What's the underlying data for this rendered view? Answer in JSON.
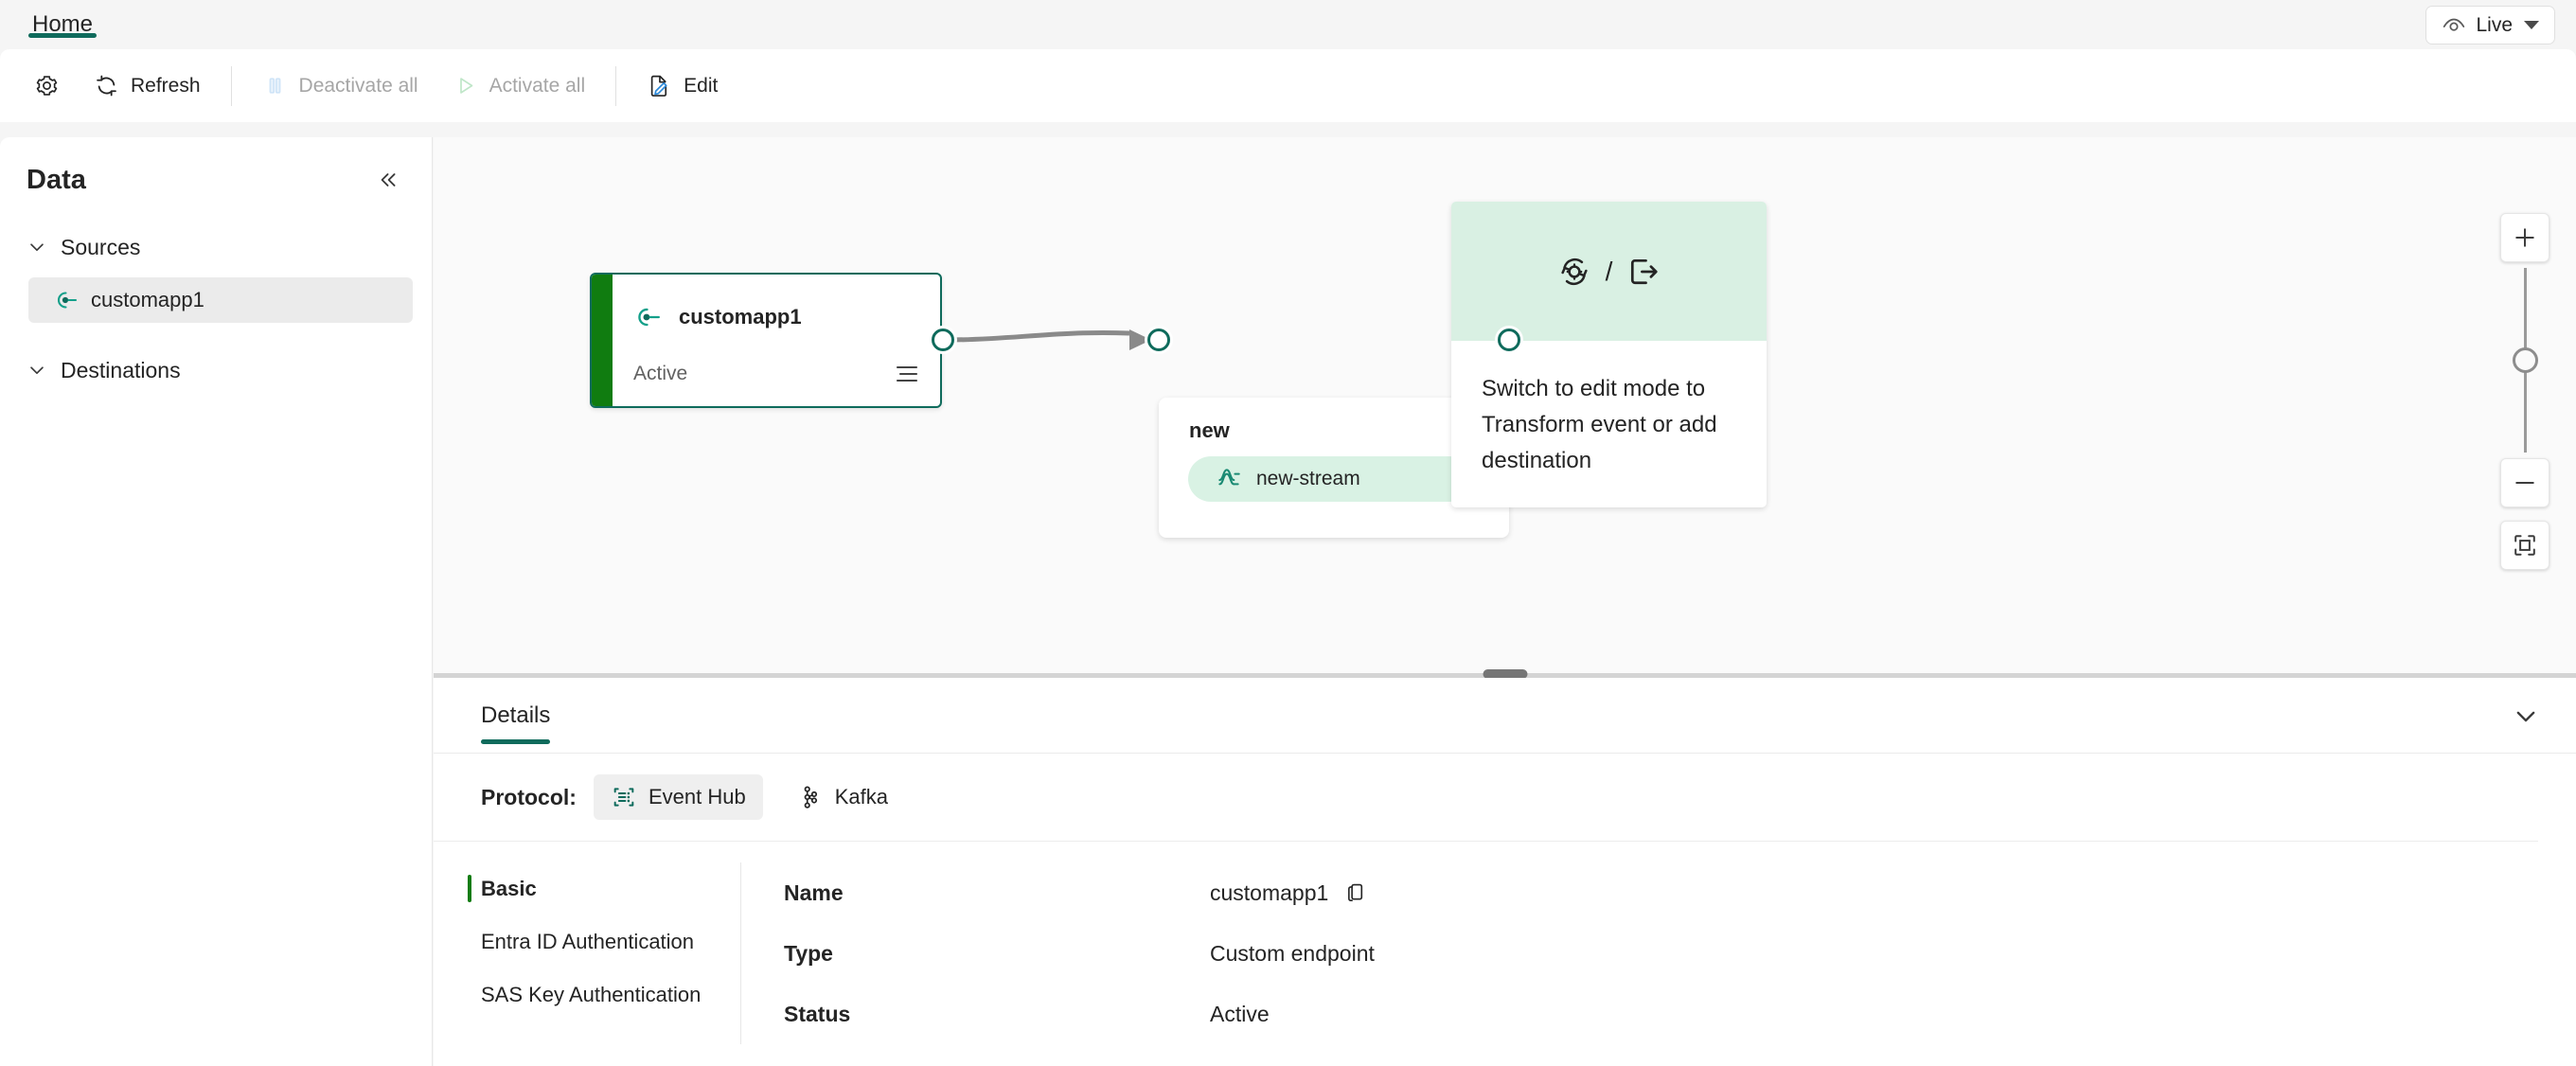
{
  "tabstrip": {
    "tabs": [
      {
        "label": "Home",
        "active": true
      }
    ],
    "live_button": {
      "label": "Live",
      "icon": "eye-icon",
      "chevron": "caret-down-icon"
    }
  },
  "commandbar": {
    "settings_label": "",
    "items": [
      {
        "label": "Refresh",
        "icon": "refresh-icon",
        "disabled": false
      },
      {
        "label": "Deactivate all",
        "icon": "pause-icon",
        "disabled": true
      },
      {
        "label": "Activate all",
        "icon": "play-icon",
        "disabled": true
      },
      {
        "label": "Edit",
        "icon": "edit-pencil-icon",
        "disabled": false
      }
    ]
  },
  "sidebar": {
    "title": "Data",
    "collapse_icon": "chevron-double-left-icon",
    "groups": [
      {
        "label": "Sources",
        "expanded": true,
        "items": [
          {
            "label": "customapp1",
            "icon": "custom-endpoint-icon",
            "selected": true
          }
        ]
      },
      {
        "label": "Destinations",
        "expanded": true,
        "items": []
      }
    ]
  },
  "canvas": {
    "source_node": {
      "title": "customapp1",
      "status": "Active",
      "icon": "custom-endpoint-icon",
      "menu_icon": "hamburger-icon",
      "border_color": "#0f6b5c",
      "stripe_color": "#107c10"
    },
    "stream_node": {
      "title": "new",
      "stream_label": "new-stream",
      "stream_icon": "eventstream-icon",
      "pill_color": "#d9f2e4"
    },
    "hint_node": {
      "icons": [
        "transform-event-icon",
        "add-destination-icon"
      ],
      "separator": "/",
      "text": "Switch to edit mode to Transform event or add destination",
      "header_color": "#d9f0e3"
    },
    "zoom_controls": {
      "zoom_in": "plus-icon",
      "zoom_out": "minus-icon",
      "fit_to_screen": "fit-to-screen-icon",
      "slider_value": 50
    }
  },
  "splitter": {
    "grip": "drag-handle"
  },
  "details": {
    "tabs": [
      {
        "label": "Details",
        "active": true
      }
    ],
    "collapse_icon": "chevron-down-icon",
    "protocol": {
      "label": "Protocol:",
      "options": [
        {
          "label": "Event Hub",
          "icon": "event-hub-icon",
          "selected": true
        },
        {
          "label": "Kafka",
          "icon": "kafka-icon",
          "selected": false
        }
      ]
    },
    "nav": [
      {
        "label": "Basic",
        "active": true
      },
      {
        "label": "Entra ID Authentication",
        "active": false
      },
      {
        "label": "SAS Key Authentication",
        "active": false
      }
    ],
    "fields": [
      {
        "key": "Name",
        "value": "customapp1",
        "copyable": true,
        "copy_icon": "copy-icon"
      },
      {
        "key": "Type",
        "value": "Custom endpoint",
        "copyable": false
      },
      {
        "key": "Status",
        "value": "Active",
        "copyable": false
      }
    ]
  },
  "theme": {
    "accent": "#0f6b5c",
    "active_green": "#107c10",
    "pill_green": "#d9f2e4",
    "canvas_bg": "#fafafa",
    "app_bg": "#f5f5f5"
  }
}
